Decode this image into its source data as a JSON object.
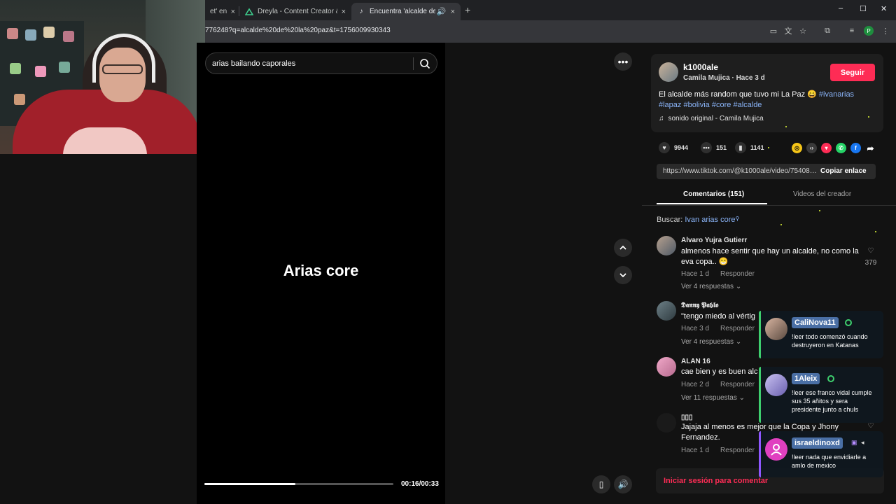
{
  "browser": {
    "tabs": [
      {
        "title": "et' en",
        "close": "×"
      },
      {
        "title": "Dreyla - Content Creator & Streamer",
        "close": "×"
      },
      {
        "title": "Encuentra 'alcalde de la paz'",
        "close": "×"
      }
    ],
    "new_tab": "+",
    "url": "776248?q=alcalde%20de%20la%20paz&t=1756009930343",
    "profile_initial": "P",
    "window_controls": [
      "–",
      "☐",
      "✕"
    ]
  },
  "video": {
    "search_value": "arias bailando caporales",
    "caption": "Arias core",
    "time": "00:16/00:33",
    "progress": 0.48
  },
  "post": {
    "username": "k1000ale",
    "subline": "Camila Mujica · Hace 3 d",
    "follow_label": "Seguir",
    "desc_text": "El alcalde más random que tuvo mi La Paz 😄 ",
    "tags": [
      "#ivanarias",
      "#lapaz",
      "#bolivia",
      "#core",
      "#alcalde"
    ],
    "sound": "sonido original - Camila Mujica",
    "likes": "9944",
    "comments": "151",
    "saves": "1141",
    "share_link": "https://www.tiktok.com/@k1000ale/video/754086...",
    "copy_label": "Copiar enlace"
  },
  "comments_panel": {
    "tab_comments": "Comentarios (151)",
    "tab_videos": "Videos del creador",
    "search_label": "Buscar:",
    "search_query": "Ivan arias core",
    "items": [
      {
        "name": "Alvaro Yujra Gutierr",
        "text": "almenos hace sentir que hay un alcalde, no como la eva copa.. 😁",
        "time": "Hace 1 d",
        "reply": "Responder",
        "more": "Ver 4 respuestas ⌄",
        "likes": "379"
      },
      {
        "name": "𝕯𝖆𝖓𝖓𝖞 𝕻𝖆𝖇𝖑𝖔",
        "text": "\"tengo miedo al vértig",
        "time": "Hace 3 d",
        "reply": "Responder",
        "more": "Ver 4 respuestas ⌄",
        "likes": ""
      },
      {
        "name": "ALAN 16",
        "text": "cae bien y es buen alc",
        "time": "Hace 2 d",
        "reply": "Responder",
        "more": "Ver 11 respuestas ⌄",
        "likes": ""
      },
      {
        "name": "▯▯▯",
        "text": "Jajaja al menos es mejor que la Copa y Jhony Fernandez.",
        "time": "Hace 1 d",
        "reply": "Responder",
        "more": "",
        "likes": ""
      }
    ],
    "login_label": "Iniciar sesión para comentar"
  },
  "stream_chat": [
    {
      "name": "CaliNova11",
      "message": "!leer todo comenzó cuando destruyeron en Katanas",
      "color": "#3ecf6e"
    },
    {
      "name": "1Aleix",
      "message": "!leer ese franco vidal cumple sus 35 añitos y sera presidente junto a chuls",
      "color": "#3ecf6e"
    },
    {
      "name": "israeldinoxd",
      "message": "!leer nada que envidiarle a amlo de mexico",
      "color": "#8f57ff"
    }
  ],
  "colors": {
    "accent": "#fe2c55",
    "tag": "#8ab4f8",
    "chat_green": "#3ecf6e",
    "chat_purple": "#8f57ff"
  }
}
